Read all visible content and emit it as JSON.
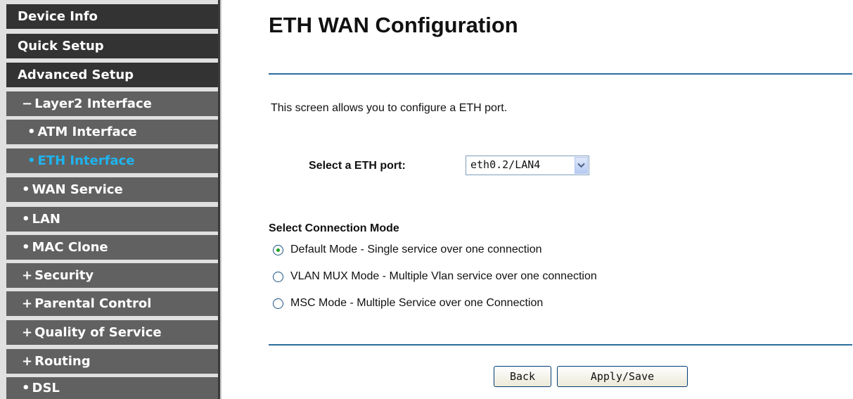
{
  "sidebar": {
    "items": [
      {
        "label": "Device Info"
      },
      {
        "label": "Quick Setup"
      },
      {
        "label": "Advanced Setup"
      },
      {
        "prefix": "−",
        "label": "Layer2 Interface"
      },
      {
        "prefix": "•",
        "label": "ATM Interface"
      },
      {
        "prefix": "•",
        "label": "ETH Interface",
        "active": true
      },
      {
        "prefix": "•",
        "label": "WAN Service"
      },
      {
        "prefix": "•",
        "label": "LAN"
      },
      {
        "prefix": "•",
        "label": "MAC Clone"
      },
      {
        "prefix": "+",
        "label": "Security"
      },
      {
        "prefix": "+",
        "label": "Parental Control"
      },
      {
        "prefix": "+",
        "label": "Quality of Service"
      },
      {
        "prefix": "+",
        "label": "Routing"
      },
      {
        "prefix": "•",
        "label": "DSL"
      }
    ]
  },
  "main": {
    "title": "ETH WAN Configuration",
    "intro": "This screen allows you to configure a ETH port.",
    "port_label": "Select a ETH port:",
    "port_value": "eth0.2/LAN4",
    "mode_heading": "Select Connection Mode",
    "modes": [
      {
        "label": "Default Mode - Single service over one connection",
        "checked": true
      },
      {
        "label": "VLAN MUX Mode - Multiple Vlan service over one connection",
        "checked": false
      },
      {
        "label": "MSC Mode - Multiple Service over one Connection",
        "checked": false
      }
    ],
    "back_label": "Back",
    "apply_label": "Apply/Save"
  },
  "colors": {
    "accent": "#1fb4f0",
    "divider": "#2c6d9c",
    "nav_dark": "#333333",
    "nav_sub": "#616161"
  }
}
